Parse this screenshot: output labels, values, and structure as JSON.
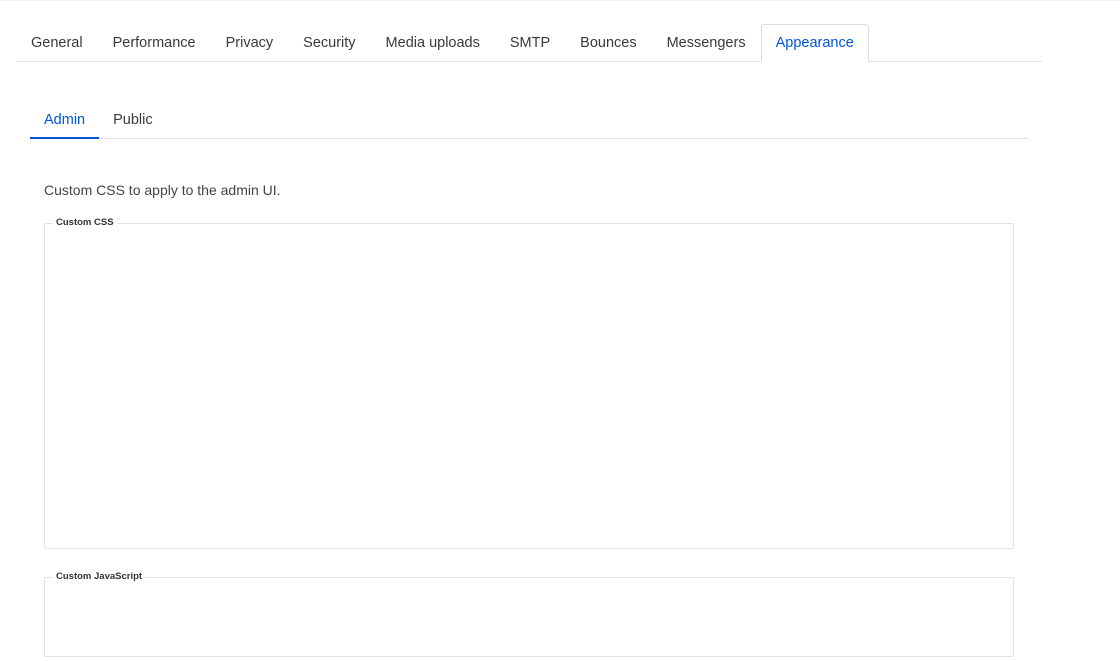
{
  "main_tabs": [
    {
      "label": "General",
      "active": false
    },
    {
      "label": "Performance",
      "active": false
    },
    {
      "label": "Privacy",
      "active": false
    },
    {
      "label": "Security",
      "active": false
    },
    {
      "label": "Media uploads",
      "active": false
    },
    {
      "label": "SMTP",
      "active": false
    },
    {
      "label": "Bounces",
      "active": false
    },
    {
      "label": "Messengers",
      "active": false
    },
    {
      "label": "Appearance",
      "active": true
    }
  ],
  "sub_tabs": [
    {
      "label": "Admin",
      "active": true
    },
    {
      "label": "Public",
      "active": false
    }
  ],
  "admin": {
    "help_text": "Custom CSS to apply to the admin UI.",
    "custom_css": {
      "label": "Custom CSS",
      "value": ""
    },
    "custom_js": {
      "label": "Custom JavaScript",
      "value": ""
    }
  },
  "colors": {
    "accent": "#0055d4",
    "border": "#dddddd",
    "text": "#3a3a3a"
  }
}
